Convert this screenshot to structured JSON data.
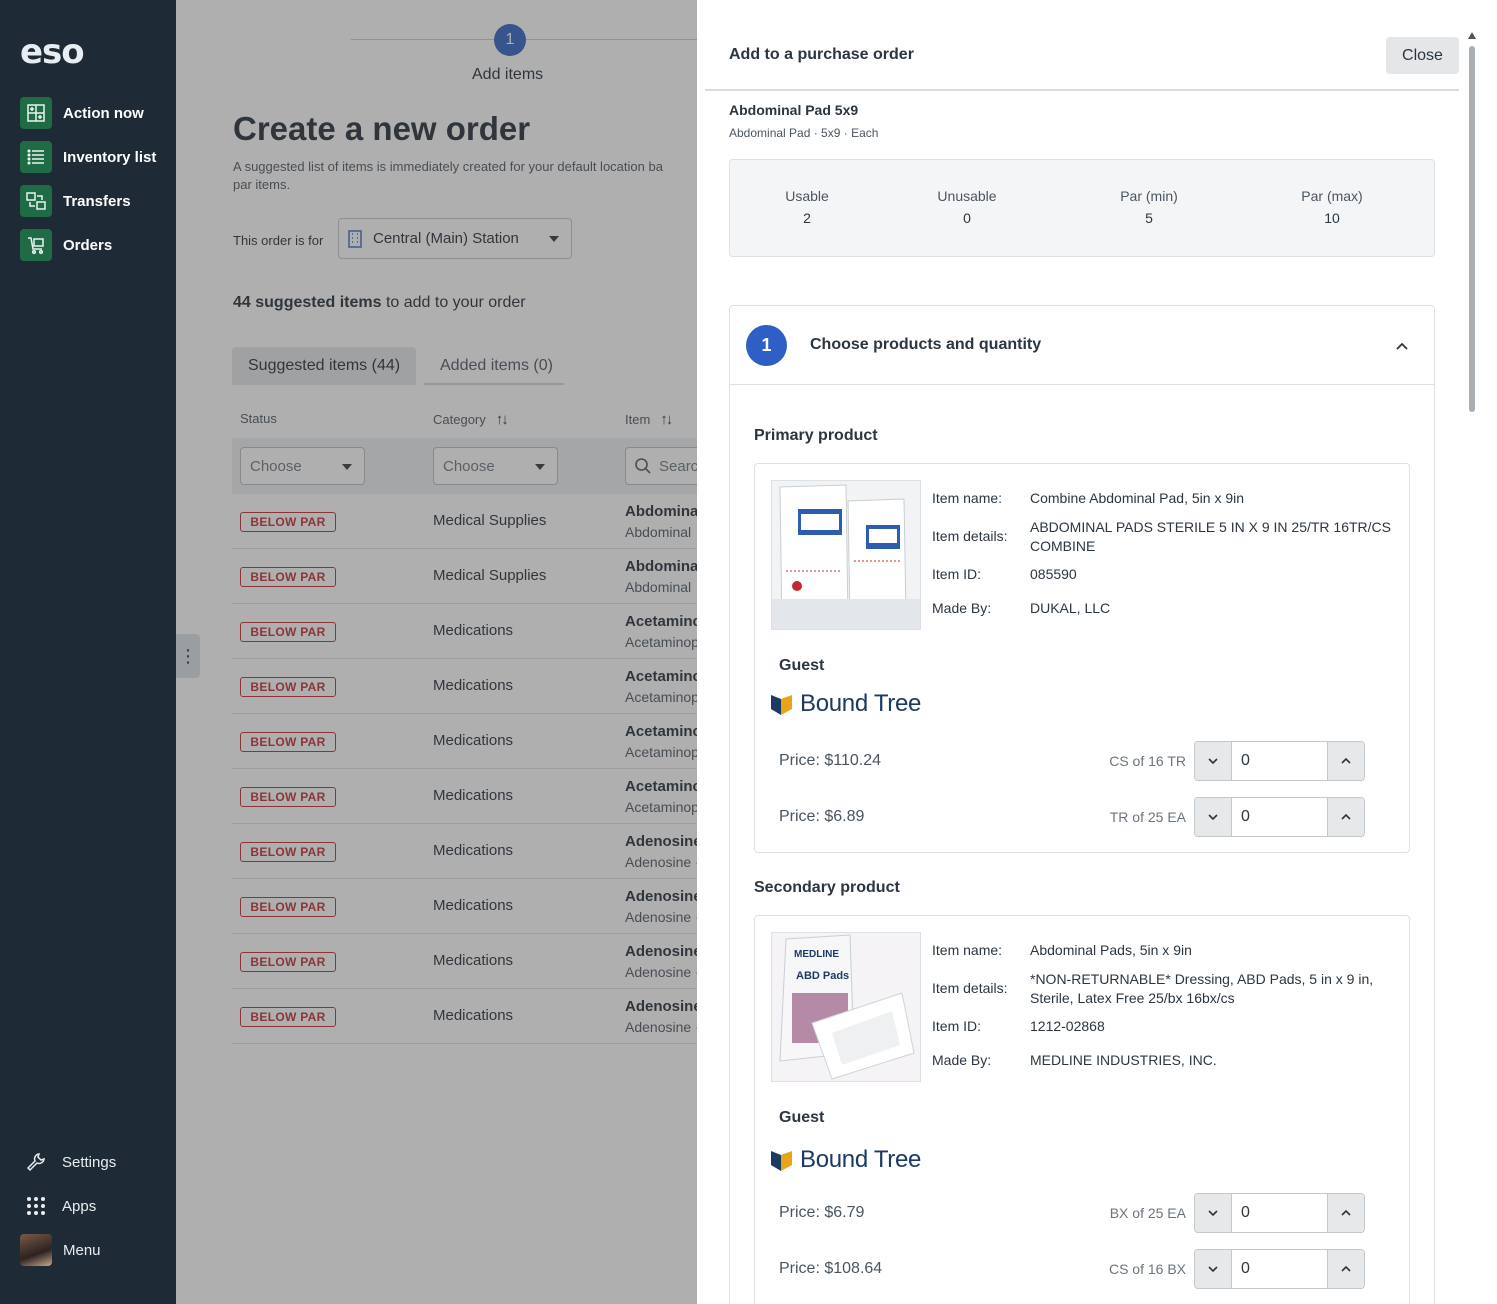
{
  "sidebar": {
    "logo": "eso",
    "nav": [
      {
        "label": "Action now",
        "icon": "action-now-icon"
      },
      {
        "label": "Inventory list",
        "icon": "list-icon"
      },
      {
        "label": "Transfers",
        "icon": "transfers-icon"
      },
      {
        "label": "Orders",
        "icon": "cart-icon"
      }
    ],
    "bottom": [
      {
        "label": "Settings",
        "icon": "wrench-icon"
      },
      {
        "label": "Apps",
        "icon": "apps-grid-icon"
      },
      {
        "label": "Menu",
        "icon": "avatar"
      }
    ]
  },
  "main": {
    "step": {
      "number": "1",
      "label": "Add items"
    },
    "title": "Create a new order",
    "description": "A suggested list of items is immediately created for your default location ba",
    "description2": "par items.",
    "order_for_label": "This order is for",
    "location": "Central (Main) Station",
    "suggest_count_bold": "44 suggested items",
    "suggest_count_rest": " to add to your order",
    "tabs": {
      "suggested": "Suggested items (44)",
      "added": "Added items (0)"
    },
    "columns": {
      "status": "Status",
      "category": "Category",
      "item": "Item"
    },
    "filters": {
      "status": "Choose",
      "category": "Choose",
      "search": "Search"
    },
    "rows": [
      {
        "status": "BELOW PAR",
        "category": "Medical Supplies",
        "item": "Abdominal",
        "sub": "Abdominal"
      },
      {
        "status": "BELOW PAR",
        "category": "Medical Supplies",
        "item": "Abdominal",
        "sub": "Abdominal"
      },
      {
        "status": "BELOW PAR",
        "category": "Medications",
        "item": "Acetaminc",
        "sub": "Acetaminop"
      },
      {
        "status": "BELOW PAR",
        "category": "Medications",
        "item": "Acetaminc",
        "sub": "Acetaminop"
      },
      {
        "status": "BELOW PAR",
        "category": "Medications",
        "item": "Acetaminc",
        "sub": "Acetaminop"
      },
      {
        "status": "BELOW PAR",
        "category": "Medications",
        "item": "Acetaminc",
        "sub": "Acetaminop"
      },
      {
        "status": "BELOW PAR",
        "category": "Medications",
        "item": "Adenosine",
        "sub": "Adenosine ·"
      },
      {
        "status": "BELOW PAR",
        "category": "Medications",
        "item": "Adenosine",
        "sub": "Adenosine ·"
      },
      {
        "status": "BELOW PAR",
        "category": "Medications",
        "item": "Adenosine",
        "sub": "Adenosine ·"
      },
      {
        "status": "BELOW PAR",
        "category": "Medications",
        "item": "Adenosine",
        "sub": "Adenosine ·"
      }
    ]
  },
  "panel": {
    "title": "Add to a purchase order",
    "close": "Close",
    "item_name": "Abdominal Pad 5x9",
    "item_sub": "Abdominal Pad · 5x9 · Each",
    "stats": [
      {
        "label": "Usable",
        "value": "2"
      },
      {
        "label": "Unusable",
        "value": "0"
      },
      {
        "label": "Par (min)",
        "value": "5"
      },
      {
        "label": "Par (max)",
        "value": "10"
      }
    ],
    "accordion": {
      "number": "1",
      "title": "Choose products and quantity"
    },
    "labels": {
      "item_name": "Item name:",
      "item_details": "Item details:",
      "item_id": "Item ID:",
      "made_by": "Made By:"
    },
    "primary": {
      "heading": "Primary product",
      "name": "Combine Abdominal Pad, 5in x 9in",
      "details": "ABDOMINAL PADS STERILE 5 IN X 9 IN 25/TR 16TR/CS COMBINE",
      "id": "085590",
      "made_by": "DUKAL, LLC",
      "account": "Guest",
      "vendor": "Bound Tree",
      "prices": [
        {
          "price": "Price: $110.24",
          "unit": "CS of 16 TR",
          "qty": "0"
        },
        {
          "price": "Price: $6.89",
          "unit": "TR of 25 EA",
          "qty": "0"
        }
      ]
    },
    "secondary": {
      "heading": "Secondary product",
      "name": "Abdominal Pads, 5in x 9in",
      "details": "*NON-RETURNABLE* Dressing, ABD Pads, 5 in x 9 in, Sterile, Latex Free 25/bx 16bx/cs",
      "id": "1212-02868",
      "made_by": "MEDLINE INDUSTRIES, INC.",
      "account": "Guest",
      "vendor": "Bound Tree",
      "prices": [
        {
          "price": "Price: $6.79",
          "unit": "BX of 25 EA",
          "qty": "0"
        },
        {
          "price": "Price: $108.64",
          "unit": "CS of 16 BX",
          "qty": "0"
        }
      ]
    }
  },
  "colors": {
    "sidebar": "#1e2a35",
    "nav_icon": "#1f6b45",
    "accent": "#2f5fc4",
    "below_par": "#c0292f",
    "vendor": "#1c3b63"
  }
}
